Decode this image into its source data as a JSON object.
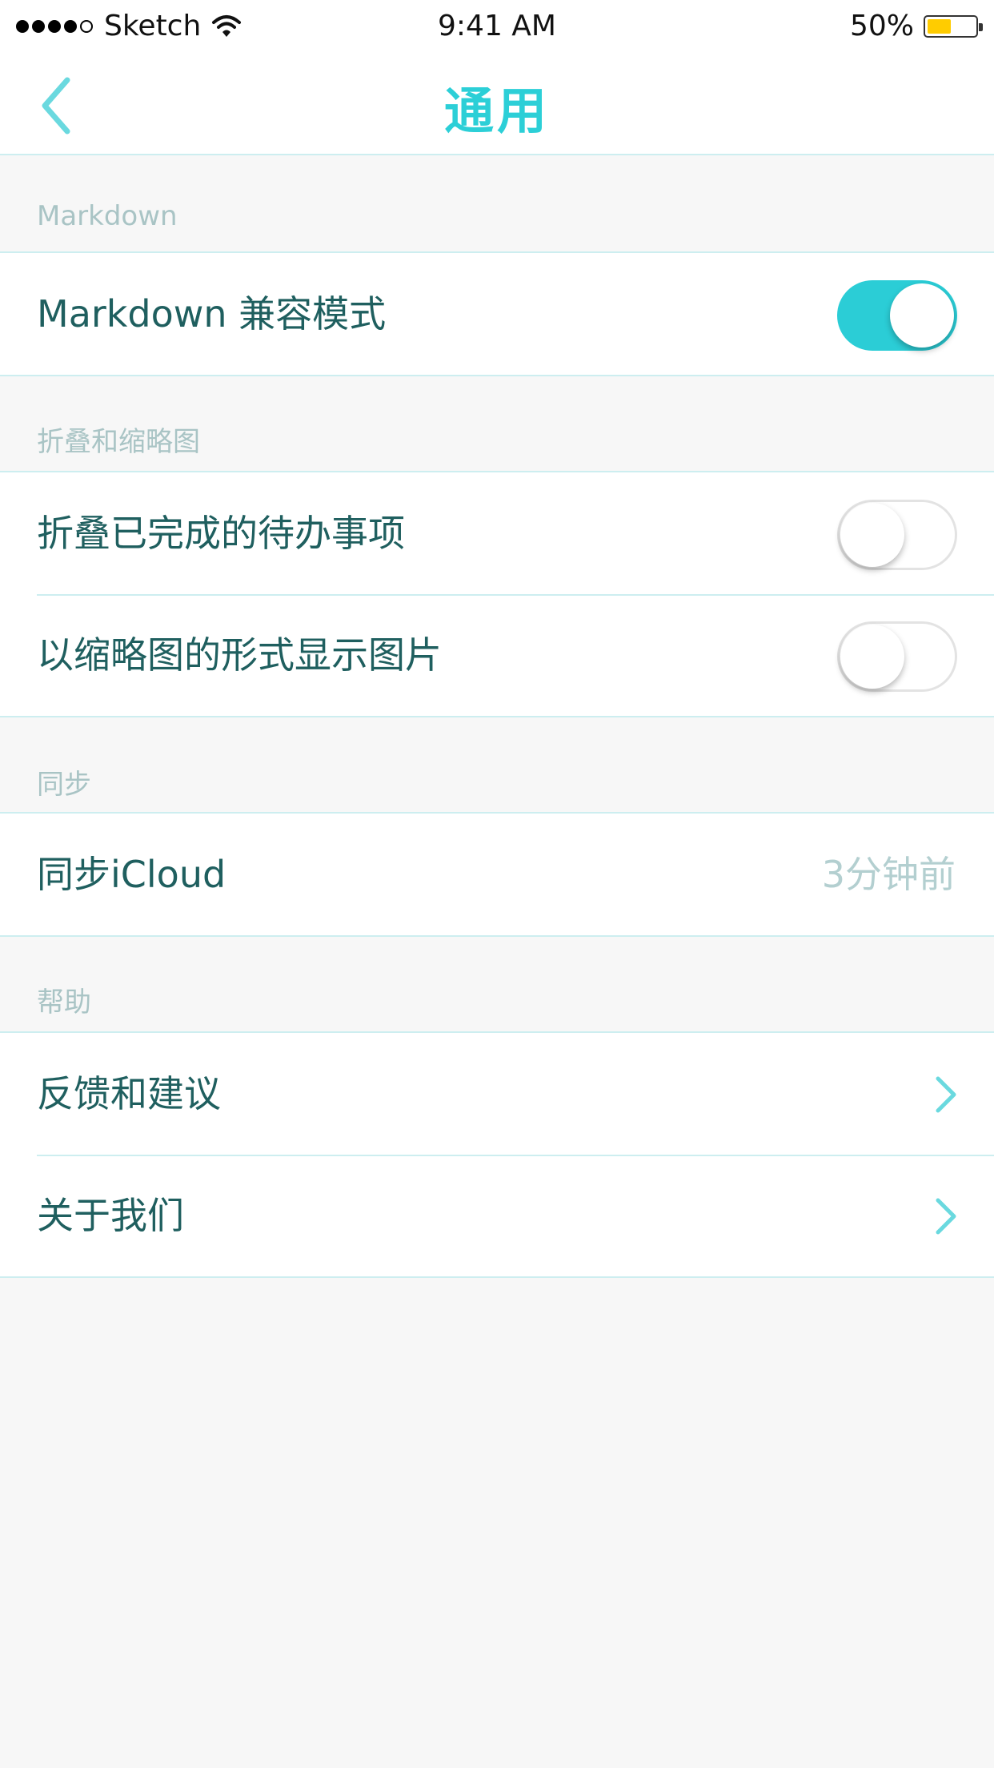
{
  "status_bar": {
    "carrier": "Sketch",
    "time": "9:41 AM",
    "battery_percent": "50%",
    "battery_level": 0.5,
    "signal_bars": 4,
    "icons": [
      "signal-dots-icon",
      "wifi-icon",
      "battery-icon"
    ]
  },
  "nav": {
    "title": "通用",
    "back_icon": "chevron-left-icon"
  },
  "colors": {
    "accent": "#2ccfd7",
    "label_text": "#1f5f5f",
    "section_text": "#a9c4c5",
    "value_text": "#b3cfd0",
    "separator": "#cdeef0",
    "background": "#f7f7f7"
  },
  "sections": {
    "markdown": {
      "header": "Markdown",
      "compat_mode": {
        "label": "Markdown 兼容模式",
        "enabled": true
      }
    },
    "fold": {
      "header": "折叠和缩略图",
      "fold_done": {
        "label": "折叠已完成的待办事项",
        "enabled": false
      },
      "thumbnail": {
        "label": "以缩略图的形式显示图片",
        "enabled": false
      }
    },
    "sync": {
      "header": "同步",
      "icloud": {
        "label": "同步iCloud",
        "value": "3分钟前"
      }
    },
    "help": {
      "header": "帮助",
      "feedback": {
        "label": "反馈和建议",
        "icon": "chevron-right-icon"
      },
      "about": {
        "label": "关于我们",
        "icon": "chevron-right-icon"
      }
    }
  }
}
